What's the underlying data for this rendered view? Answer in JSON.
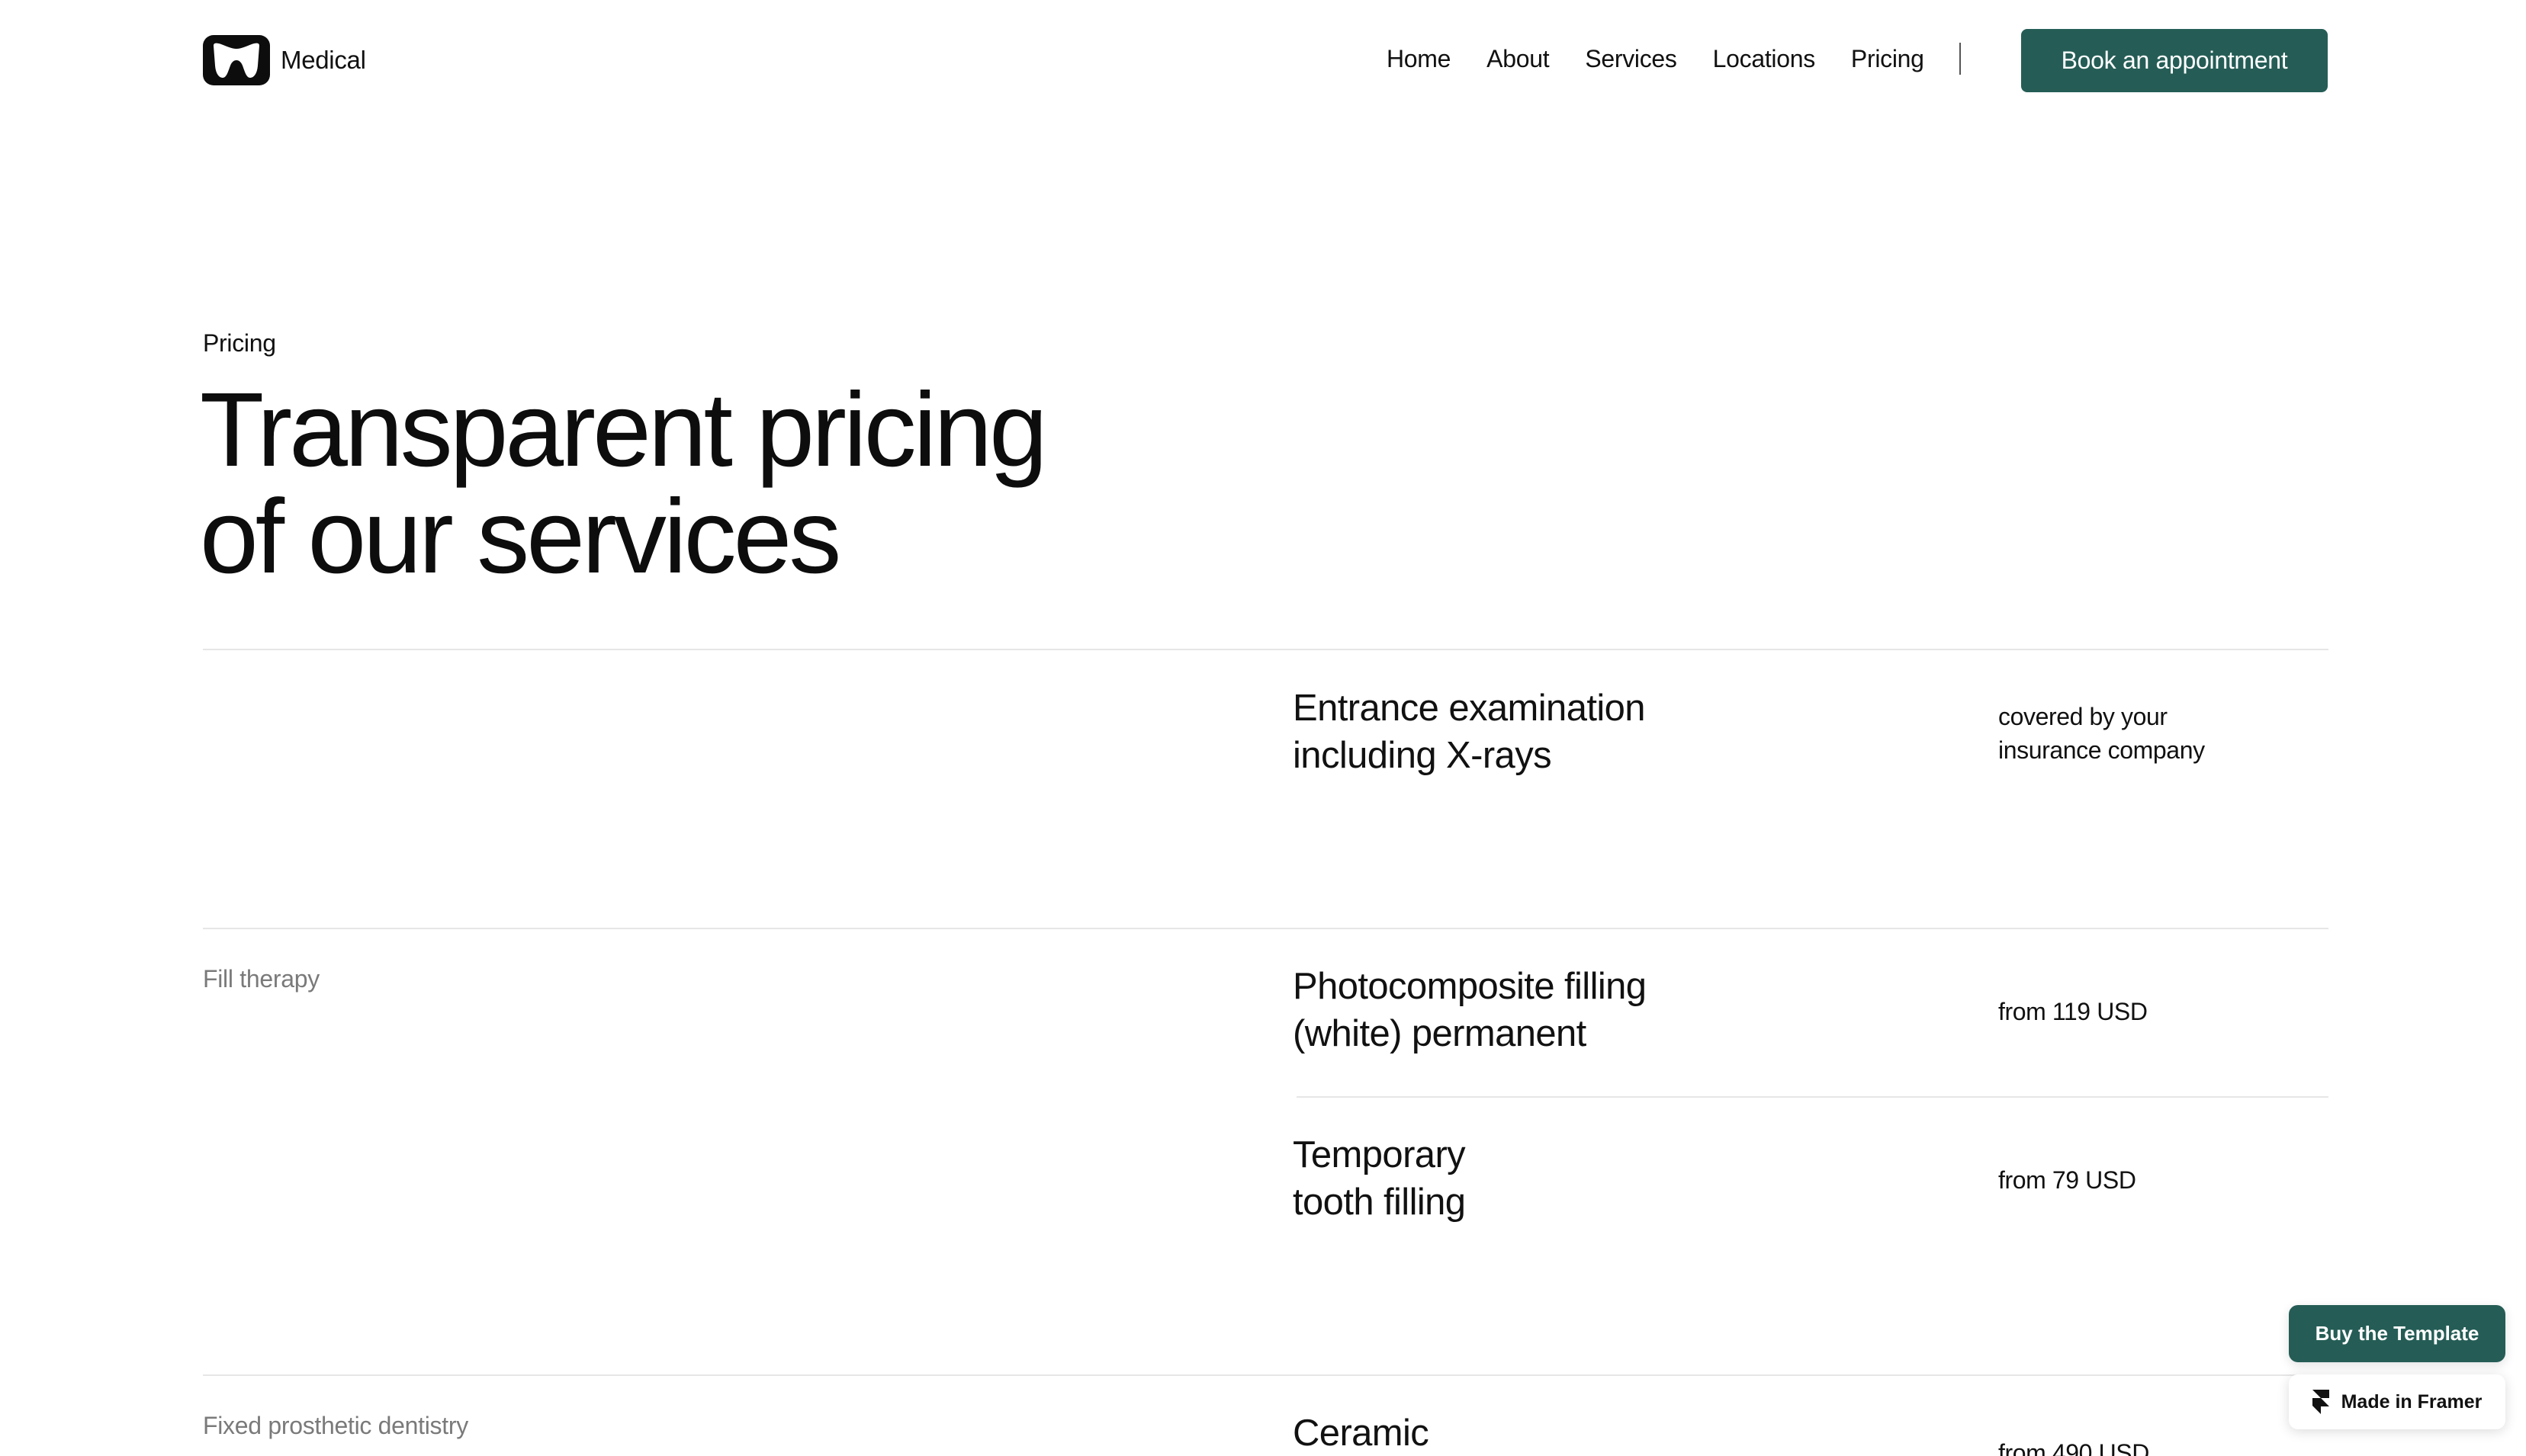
{
  "brand": {
    "name": "Medical"
  },
  "nav": {
    "items": [
      "Home",
      "About",
      "Services",
      "Locations",
      "Pricing"
    ],
    "cta": "Book an appointment"
  },
  "hero": {
    "eyebrow": "Pricing",
    "title_line1": "Transparent pricing",
    "title_line2": "of our services"
  },
  "pricing": {
    "groups": [
      {
        "category": "",
        "items": [
          {
            "name_line1": "Entrance examination",
            "name_line2": "including X-rays",
            "price_line1": "covered by your",
            "price_line2": "insurance company"
          }
        ]
      },
      {
        "category": "Fill therapy",
        "items": [
          {
            "name_line1": "Photocomposite filling",
            "name_line2": "(white) permanent",
            "price": "from 119 USD"
          },
          {
            "name_line1": "Temporary",
            "name_line2": "tooth filling",
            "price": "from 79 USD"
          }
        ]
      },
      {
        "category": "Fixed prosthetic dentistry",
        "items": [
          {
            "name_line1": "Ceramic",
            "price": "from 490 USD"
          }
        ]
      }
    ]
  },
  "floating": {
    "buy": "Buy the Template",
    "made_in": "Made in Framer"
  },
  "colors": {
    "accent": "#255d56",
    "divider": "#e6e6e6",
    "muted": "#7a7a7a"
  },
  "icons": {
    "logo": "tooth-logo-icon",
    "framer": "framer-icon"
  }
}
